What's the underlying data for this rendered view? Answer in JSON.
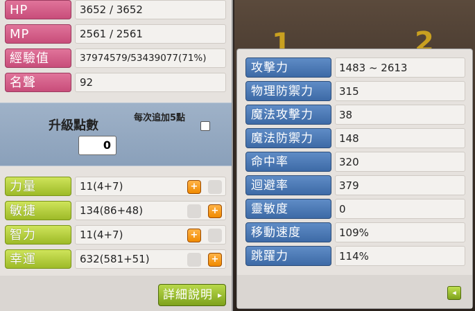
{
  "basic_stats": [
    {
      "label": "HP",
      "value": "3652 / 3652"
    },
    {
      "label": "MP",
      "value": "2561 / 2561"
    },
    {
      "label": "經驗值",
      "value": "37974579/53439077(71%)"
    },
    {
      "label": "名聲",
      "value": "92"
    }
  ],
  "ability_points": {
    "label": "升級點數",
    "value": "0",
    "bulk_add_label": "每次追加5點",
    "bulk_add_checked": false
  },
  "attributes": [
    {
      "label": "力量",
      "value": "11(4+7)",
      "plus_enabled": true
    },
    {
      "label": "敏捷",
      "value": "134(86+48)",
      "plus_enabled": true
    },
    {
      "label": "智力",
      "value": "11(4+7)",
      "plus_enabled": true
    },
    {
      "label": "幸運",
      "value": "632(581+51)",
      "plus_enabled": true
    }
  ],
  "detail_button": {
    "label": "詳細說明",
    "arrow": "▸"
  },
  "scene": {
    "digit_left": "1",
    "digit_right": "2"
  },
  "detail_stats": [
    {
      "label": "攻擊力",
      "value": "1483 ~ 2613"
    },
    {
      "label": "物理防禦力",
      "value": "315"
    },
    {
      "label": "魔法攻擊力",
      "value": "38"
    },
    {
      "label": "魔法防禦力",
      "value": "148"
    },
    {
      "label": "命中率",
      "value": "320"
    },
    {
      "label": "迴避率",
      "value": "379"
    },
    {
      "label": "靈敏度",
      "value": "0"
    },
    {
      "label": "移動速度",
      "value": "109%"
    },
    {
      "label": "跳躍力",
      "value": "114%"
    }
  ],
  "collapse_button": {
    "icon": "arrow-left-icon",
    "glyph": "◂"
  },
  "colors": {
    "pink_label": "#d45f88",
    "green_label": "#a8c22e",
    "blue_label": "#4a78b4",
    "plus_button": "#f59a10"
  }
}
